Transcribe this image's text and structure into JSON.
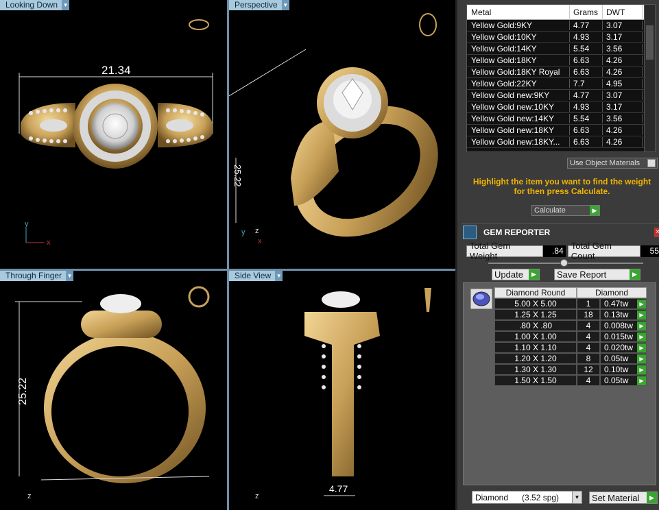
{
  "viewports": {
    "top_left": {
      "label": "Looking Down",
      "dim": "21.34",
      "axis_y": "y",
      "axis_x": "x"
    },
    "top_right": {
      "label": "Perspective",
      "dim": "25.22",
      "axis_y": "y",
      "axis_x": "x",
      "axis_z": "z"
    },
    "bottom_left": {
      "label": "Through Finger",
      "dim": "25.22",
      "axis_z": "z"
    },
    "bottom_right": {
      "label": "Side View",
      "dim": "4.77",
      "axis_z": "z"
    }
  },
  "metal_table": {
    "headers": {
      "metal": "Metal",
      "grams": "Grams",
      "dwt": "DWT"
    },
    "rows": [
      {
        "metal": "Yellow Gold:9KY",
        "grams": "4.77",
        "dwt": "3.07"
      },
      {
        "metal": "Yellow Gold:10KY",
        "grams": "4.93",
        "dwt": "3.17"
      },
      {
        "metal": "Yellow Gold:14KY",
        "grams": "5.54",
        "dwt": "3.56"
      },
      {
        "metal": "Yellow Gold:18KY",
        "grams": "6.63",
        "dwt": "4.26"
      },
      {
        "metal": "Yellow Gold:18KY Royal",
        "grams": "6.63",
        "dwt": "4.26"
      },
      {
        "metal": "Yellow Gold:22KY",
        "grams": "7.7",
        "dwt": "4.95"
      },
      {
        "metal": "Yellow Gold new:9KY",
        "grams": "4.77",
        "dwt": "3.07"
      },
      {
        "metal": "Yellow Gold new:10KY",
        "grams": "4.93",
        "dwt": "3.17"
      },
      {
        "metal": "Yellow Gold new:14KY",
        "grams": "5.54",
        "dwt": "3.56"
      },
      {
        "metal": "Yellow Gold new:18KY",
        "grams": "6.63",
        "dwt": "4.26"
      },
      {
        "metal": "Yellow Gold new:18KY...",
        "grams": "6.63",
        "dwt": "4.26"
      }
    ]
  },
  "use_object_materials": "Use Object Materials",
  "hint": "Highlight the item you want to find the weight for then press Calculate.",
  "calculate_label": "Calculate",
  "gem_reporter": {
    "title": "GEM REPORTER",
    "total_weight_label": "Total Gem Weight",
    "total_weight_value": ".84",
    "total_count_label": "Total Gem Count",
    "total_count_value": "55",
    "update_label": "Update",
    "save_report_label": "Save Report",
    "table_headers": {
      "shape": "Diamond Round",
      "material": "Diamond"
    },
    "rows": [
      {
        "size": "5.00 X 5.00",
        "count": "1",
        "tw": "0.47tw"
      },
      {
        "size": "1.25 X 1.25",
        "count": "18",
        "tw": "0.13tw"
      },
      {
        "size": ".80 X .80",
        "count": "4",
        "tw": "0.008tw"
      },
      {
        "size": "1.00 X 1.00",
        "count": "4",
        "tw": "0.015tw"
      },
      {
        "size": "1.10 X 1.10",
        "count": "4",
        "tw": "0.020tw"
      },
      {
        "size": "1.20 X 1.20",
        "count": "8",
        "tw": "0.05tw"
      },
      {
        "size": "1.30 X 1.30",
        "count": "12",
        "tw": "0.10tw"
      },
      {
        "size": "1.50 X 1.50",
        "count": "4",
        "tw": "0.05tw"
      }
    ],
    "material_select": "Diamond      (3.52 spg)",
    "set_material_label": "Set Material"
  },
  "colors": {
    "gold": "#c9a25a",
    "gold_dark": "#8a6a2e",
    "hint": "#f0b400",
    "go": "#3aa531",
    "viewport_label": "#a9c9dc"
  }
}
